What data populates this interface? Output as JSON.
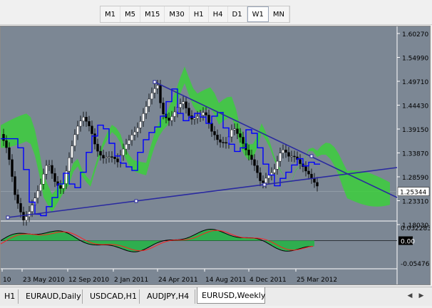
{
  "toolbar": {
    "timeframes": [
      "M1",
      "M5",
      "M15",
      "M30",
      "H1",
      "H4",
      "D1",
      "W1",
      "MN"
    ],
    "active": "W1"
  },
  "chart_data": {
    "type": "line",
    "symbol": "EURUSD",
    "period": "Weekly",
    "price_axis": [
      "1.60270",
      "1.54990",
      "1.49710",
      "1.44430",
      "1.39150",
      "1.33870",
      "1.28590",
      "1.23310",
      "1.18030"
    ],
    "current_price": "1.25344",
    "time_axis": [
      "10",
      "23 May 2010",
      "12 Sep 2010",
      "2 Jan 2011",
      "24 Apr 2011",
      "14 Aug 2011",
      "4 Dec 2011",
      "25 Mar 2012"
    ],
    "oscillator_axis": [
      "0.032283",
      "0.00",
      "-0.05476"
    ],
    "colors": {
      "background": "#7c8794",
      "bull_candle": "#ffffff",
      "bear_candle": "#000000",
      "kijun": "#0000ff",
      "kumo_bull": "#3ccf3c",
      "kumo_bear": "#4aa86a",
      "trendline": "#2a2aa0",
      "macd_line": "#000000",
      "signal_line": "#ff2020",
      "histogram": "#2fae4f"
    }
  },
  "tabs": {
    "items": [
      "H1",
      "EURAUD,Daily",
      "USDCAD,H1",
      "AUDJPY,H4",
      "EURUSD,Weekly"
    ],
    "active": "EURUSD,Weekly"
  }
}
